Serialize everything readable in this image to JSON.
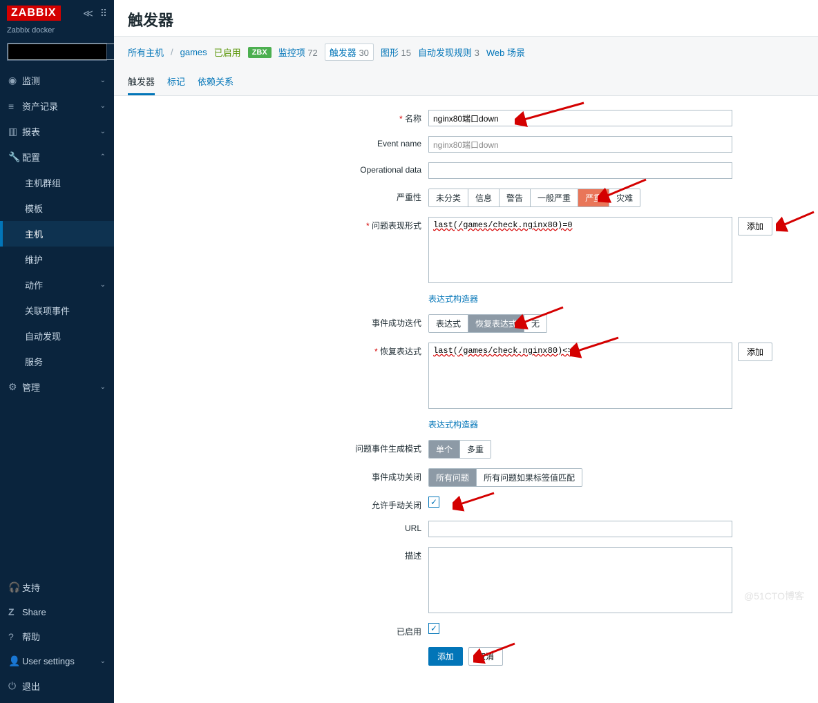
{
  "app": {
    "logo": "ZABBIX",
    "subtitle": "Zabbix docker"
  },
  "sidebar": {
    "search_placeholder": "",
    "items": [
      {
        "icon": "eye",
        "label": "监测"
      },
      {
        "icon": "list",
        "label": "资产记录"
      },
      {
        "icon": "bar",
        "label": "报表"
      },
      {
        "icon": "wrench",
        "label": "配置"
      }
    ],
    "config_sub": [
      {
        "label": "主机群组"
      },
      {
        "label": "模板"
      },
      {
        "label": "主机"
      },
      {
        "label": "维护"
      },
      {
        "label": "动作"
      },
      {
        "label": "关联项事件"
      },
      {
        "label": "自动发现"
      },
      {
        "label": "服务"
      }
    ],
    "admin_label": "管理",
    "bottom": [
      {
        "icon": "headset",
        "label": "支持"
      },
      {
        "icon": "z",
        "label": "Share"
      },
      {
        "icon": "question",
        "label": "帮助"
      },
      {
        "icon": "user",
        "label": "User settings"
      },
      {
        "icon": "power",
        "label": "退出"
      }
    ]
  },
  "page": {
    "title": "触发器"
  },
  "crumbs": {
    "all_hosts": "所有主机",
    "host": "games",
    "enabled": "已启用",
    "zbx": "ZBX",
    "items": {
      "label": "监控项",
      "count": "72"
    },
    "triggers": {
      "label": "触发器",
      "count": "30"
    },
    "graphs": {
      "label": "图形",
      "count": "15"
    },
    "discovery": {
      "label": "自动发现规则",
      "count": "3"
    },
    "web": "Web 场景"
  },
  "tabs": {
    "t1": "触发器",
    "t2": "标记",
    "t3": "依赖关系"
  },
  "form": {
    "name_label": "名称",
    "name_value": "nginx80端口down",
    "eventname_label": "Event name",
    "eventname_value": "nginx80端口down",
    "opdata_label": "Operational data",
    "opdata_value": "",
    "severity_label": "严重性",
    "severity_opts": [
      "未分类",
      "信息",
      "警告",
      "一般严重",
      "严重",
      "灾难"
    ],
    "problem_label": "问题表现形式",
    "problem_value": "last(/games/check.nginx80)=0",
    "add_btn": "添加",
    "expr_builder": "表达式构造器",
    "eventgen_label": "事件成功迭代",
    "eventgen_opts": [
      "表达式",
      "恢复表达式",
      "无"
    ],
    "recovery_label": "恢复表达式",
    "recovery_value": "last(/games/check.nginx80)<>0",
    "prob_mode_label": "问题事件生成模式",
    "prob_mode_opts": [
      "单个",
      "多重"
    ],
    "ok_close_label": "事件成功关闭",
    "ok_close_opts": [
      "所有问题",
      "所有问题如果标签值匹配"
    ],
    "manual_close_label": "允许手动关闭",
    "url_label": "URL",
    "url_value": "",
    "desc_label": "描述",
    "desc_value": "",
    "enabled_label": "已启用",
    "submit": "添加",
    "cancel": "取消"
  },
  "watermark": "@51CTO博客"
}
